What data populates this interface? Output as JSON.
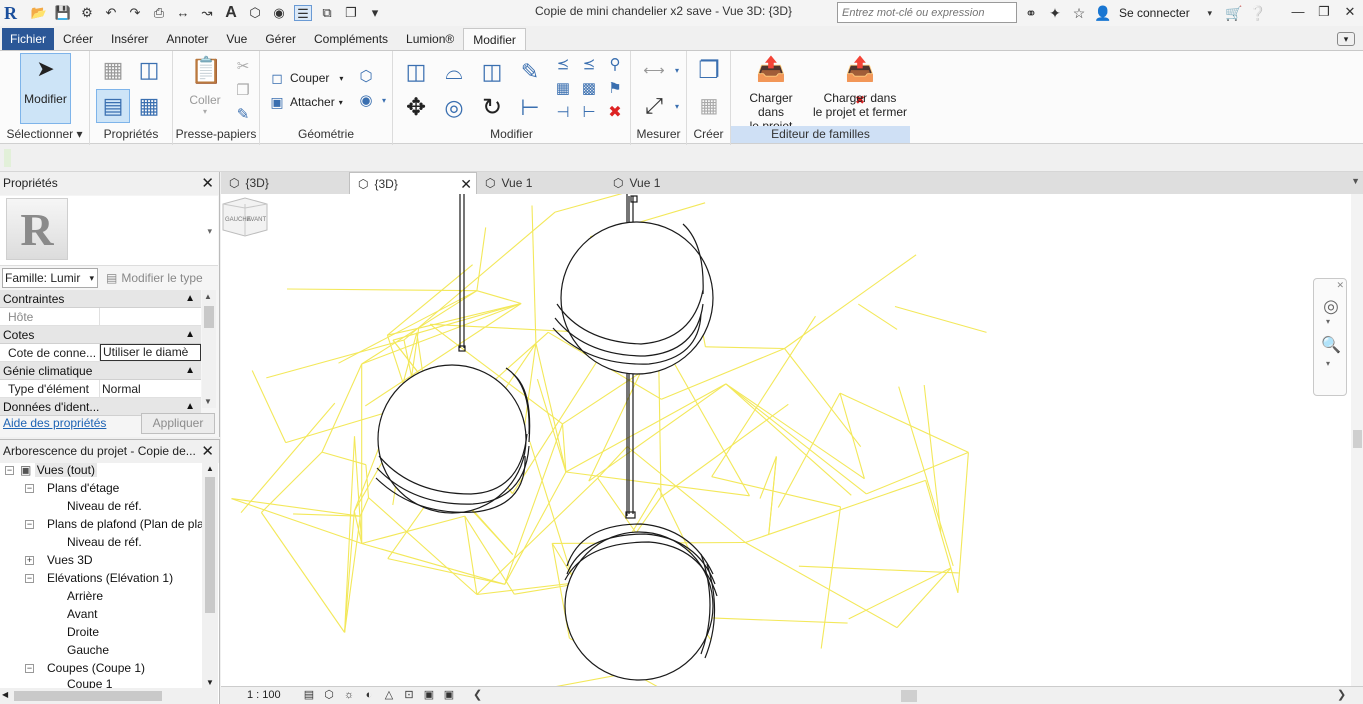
{
  "titlebar": {
    "window_title": "Copie de mini chandelier x2 save - Vue 3D: {3D}",
    "search_placeholder": "Entrez mot-clé ou expression",
    "signin_label": "Se connecter"
  },
  "menu": {
    "tabs": [
      "Fichier",
      "Créer",
      "Insérer",
      "Annoter",
      "Vue",
      "Gérer",
      "Compléments",
      "Lumion®",
      "Modifier"
    ],
    "active": "Modifier"
  },
  "ribbon": {
    "modify_label": "Modifier",
    "paste_label": "Coller",
    "cut_label": "Couper",
    "join_label": "Attacher",
    "load_project_label_1": "Charger dans",
    "load_project_label_2": "le projet",
    "load_close_label_1": "Charger dans",
    "load_close_label_2": "le projet et fermer",
    "panels": {
      "select": "Sélectionner",
      "properties": "Propriétés",
      "clipboard": "Presse-papiers",
      "geometry": "Géométrie",
      "modify": "Modifier",
      "measure": "Mesurer",
      "create": "Créer",
      "family_editor": "Editeur de familles"
    }
  },
  "properties": {
    "title": "Propriétés",
    "family_value": "Famille: Lumir",
    "edit_type_label": "Modifier le type",
    "categories": {
      "constraints": "Contraintes",
      "dimensions": "Cotes",
      "mechanical": "Génie climatique",
      "identity": "Données d'ident..."
    },
    "rows": {
      "host_name": "Hôte",
      "host_value": "",
      "conn_name": "Cote de conne...",
      "conn_value": "Utiliser le diamè",
      "type_name": "Type d'élément",
      "type_value": "Normal"
    },
    "help_link": "Aide des propriétés",
    "apply_button": "Appliquer"
  },
  "browser": {
    "title": "Arborescence du projet - Copie de...",
    "items": [
      "Vues (tout)",
      "Plans d'étage",
      "Niveau de réf.",
      "Plans de plafond (Plan de pla",
      "Niveau de réf.",
      "Vues 3D",
      "Elévations (Elévation 1)",
      "Arrière",
      "Avant",
      "Droite",
      "Gauche",
      "Coupes (Coupe 1)",
      "Coupe 1"
    ]
  },
  "view_tabs": [
    "{3D}",
    "{3D}",
    "Vue 1",
    "Vue 1"
  ],
  "viewcube": {
    "left_face": "GAUCHE",
    "front_face": "AVANT"
  },
  "status": {
    "scale": "1 : 100"
  },
  "colors": {
    "accent": "#2b5797",
    "wire": "#f3e85a",
    "ribbon_highlight": "#cde4f7"
  }
}
